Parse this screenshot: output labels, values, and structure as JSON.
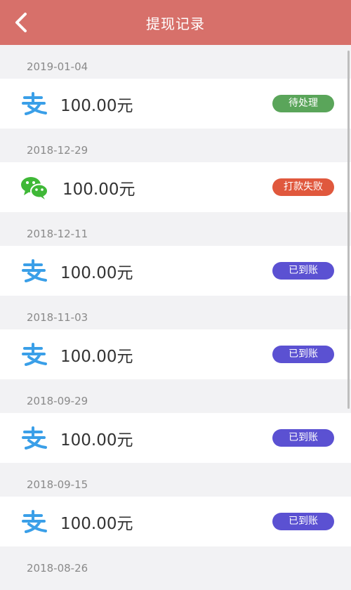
{
  "header": {
    "title": "提现记录"
  },
  "colors": {
    "header": "#d7706a",
    "pending": "#5aa55a",
    "failed": "#e0583d",
    "arrived": "#5b51d2"
  },
  "records": [
    {
      "date": "2019-01-04",
      "method": "alipay",
      "icon": "alipay-icon",
      "amount": "100.00元",
      "status": "待处理",
      "status_key": "pending"
    },
    {
      "date": "2018-12-29",
      "method": "wechat",
      "icon": "wechat-icon",
      "amount": "100.00元",
      "status": "打款失败",
      "status_key": "failed"
    },
    {
      "date": "2018-12-11",
      "method": "alipay",
      "icon": "alipay-icon",
      "amount": "100.00元",
      "status": "已到账",
      "status_key": "arrived"
    },
    {
      "date": "2018-11-03",
      "method": "alipay",
      "icon": "alipay-icon",
      "amount": "100.00元",
      "status": "已到账",
      "status_key": "arrived"
    },
    {
      "date": "2018-09-29",
      "method": "alipay",
      "icon": "alipay-icon",
      "amount": "100.00元",
      "status": "已到账",
      "status_key": "arrived"
    },
    {
      "date": "2018-09-15",
      "method": "alipay",
      "icon": "alipay-icon",
      "amount": "100.00元",
      "status": "已到账",
      "status_key": "arrived"
    }
  ],
  "trailing_date": "2018-08-26"
}
